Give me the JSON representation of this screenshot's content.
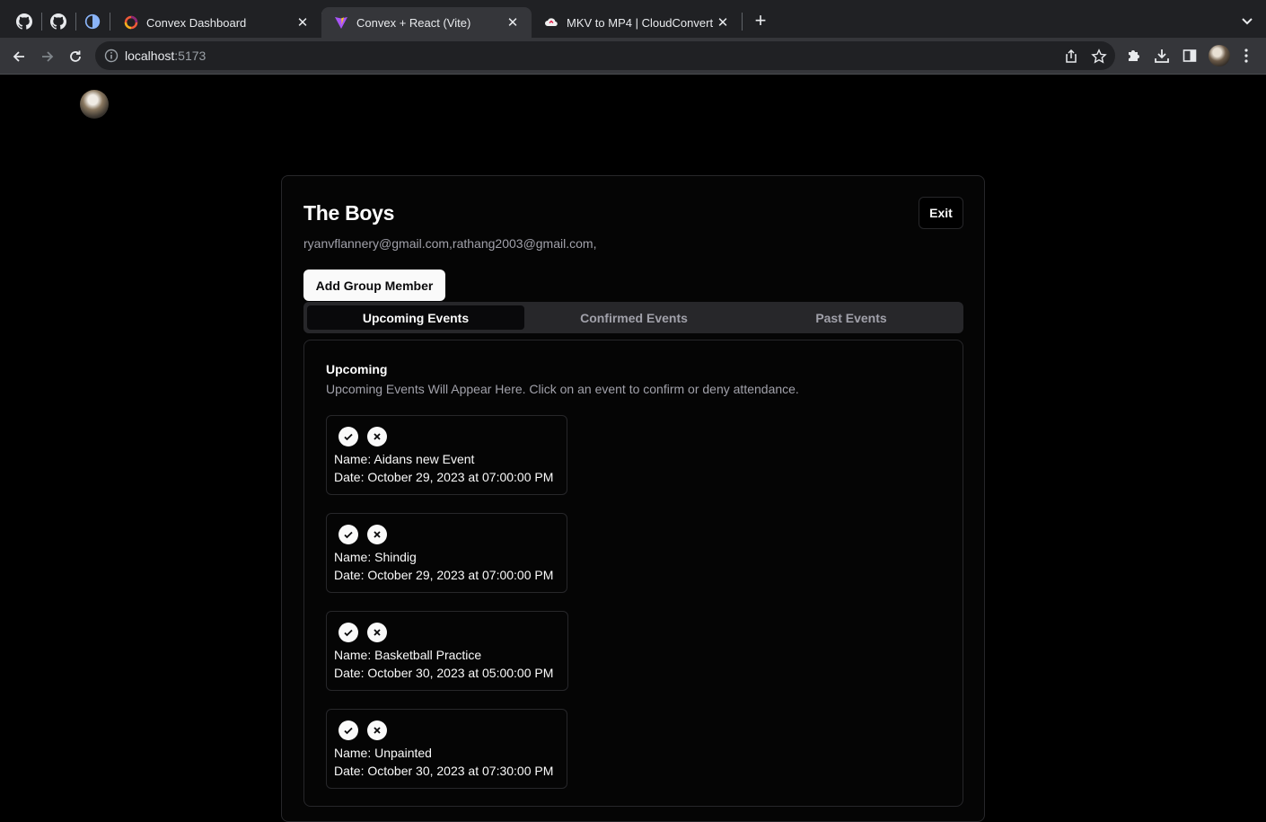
{
  "browser": {
    "tabs": [
      {
        "title": "Convex Dashboard",
        "active": false
      },
      {
        "title": "Convex + React (Vite)",
        "active": true
      },
      {
        "title": "MKV to MP4 | CloudConvert",
        "active": false
      }
    ],
    "url_host": "localhost",
    "url_port": ":5173"
  },
  "group": {
    "name": "The Boys",
    "members": "ryanvflannery@gmail.com,rathang2003@gmail.com,",
    "exit_label": "Exit",
    "add_member_label": "Add Group Member"
  },
  "tabs": {
    "upcoming": "Upcoming Events",
    "confirmed": "Confirmed Events",
    "past": "Past Events",
    "active": "upcoming"
  },
  "panel": {
    "title": "Upcoming",
    "description": "Upcoming Events Will Appear Here. Click on an event to confirm or deny attendance."
  },
  "events": [
    {
      "name": "Name: Aidans new Event",
      "date": "Date: October 29, 2023 at 07:00:00 PM"
    },
    {
      "name": "Name: Shindig",
      "date": "Date: October 29, 2023 at 07:00:00 PM"
    },
    {
      "name": "Name: Basketball Practice",
      "date": "Date: October 30, 2023 at 05:00:00 PM"
    },
    {
      "name": "Name: Unpainted",
      "date": "Date: October 30, 2023 at 07:30:00 PM"
    }
  ],
  "colors": {
    "background": "#000000",
    "muted_text": "#a1a1aa",
    "border": "#27272a",
    "primary_button": "#fafafa"
  }
}
